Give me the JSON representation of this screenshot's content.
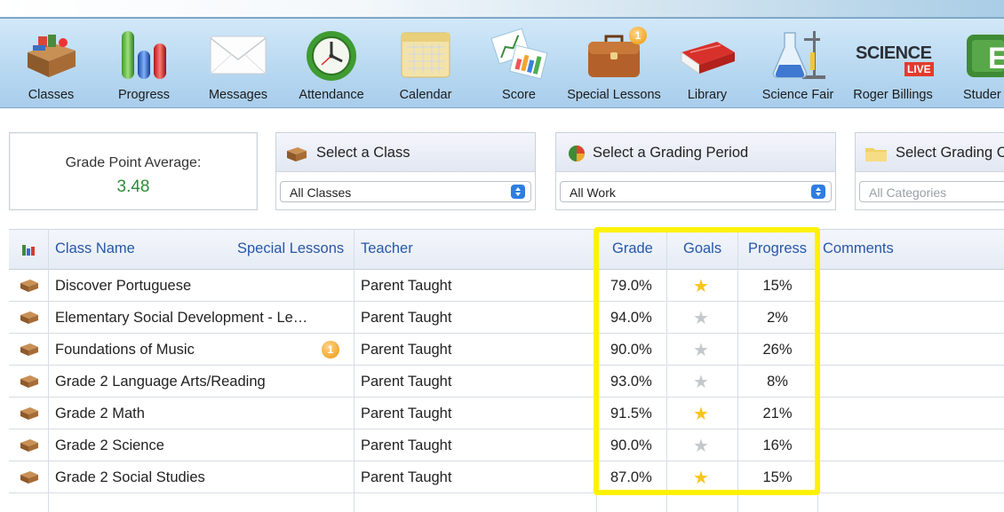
{
  "toolbar": {
    "items": [
      {
        "label": "Classes",
        "icon": "desk-icon"
      },
      {
        "label": "Progress",
        "icon": "bar-chart-icon"
      },
      {
        "label": "Messages",
        "icon": "envelope-icon"
      },
      {
        "label": "Attendance",
        "icon": "clock-icon"
      },
      {
        "label": "Calendar",
        "icon": "calendar-icon"
      },
      {
        "label": "Score",
        "icon": "charts-icon"
      },
      {
        "label": "Special Lessons",
        "icon": "briefcase-icon",
        "badge": "1"
      },
      {
        "label": "Library",
        "icon": "book-icon"
      },
      {
        "label": "Science Fair",
        "icon": "flask-icon"
      },
      {
        "label": "Roger Billings",
        "icon": "science-live-logo",
        "logo_text": "SCIENCE",
        "logo_sub": "LIVE"
      },
      {
        "label": "Studer",
        "icon": "student-icon"
      }
    ]
  },
  "gpa": {
    "label": "Grade Point Average:",
    "value": "3.48",
    "value_color": "#2e8b3a"
  },
  "filters": [
    {
      "title": "Select a Class",
      "value": "All Classes",
      "icon": "class-box-icon"
    },
    {
      "title": "Select a Grading Period",
      "value": "All Work",
      "icon": "pie-icon"
    },
    {
      "title": "Select Grading C",
      "value": "All Categories",
      "icon": "folder-icon"
    }
  ],
  "table": {
    "headers": {
      "class_name": "Class Name",
      "special_lessons": "Special Lessons",
      "teacher": "Teacher",
      "grade": "Grade",
      "goals": "Goals",
      "progress": "Progress",
      "comments": "Comments"
    },
    "rows": [
      {
        "class_name": "Discover Portuguese",
        "teacher": "Parent Taught",
        "grade": "79.0%",
        "goal": "gold",
        "progress": "15%",
        "badge": ""
      },
      {
        "class_name": "Elementary Social Development - Le…",
        "teacher": "Parent Taught",
        "grade": "94.0%",
        "goal": "gray",
        "progress": "2%",
        "badge": ""
      },
      {
        "class_name": "Foundations of Music",
        "teacher": "Parent Taught",
        "grade": "90.0%",
        "goal": "gray",
        "progress": "26%",
        "badge": "1"
      },
      {
        "class_name": "Grade 2 Language Arts/Reading",
        "teacher": "Parent Taught",
        "grade": "93.0%",
        "goal": "gray",
        "progress": "8%",
        "badge": ""
      },
      {
        "class_name": "Grade 2 Math",
        "teacher": "Parent Taught",
        "grade": "91.5%",
        "goal": "gold",
        "progress": "21%",
        "badge": ""
      },
      {
        "class_name": "Grade 2 Science",
        "teacher": "Parent Taught",
        "grade": "90.0%",
        "goal": "gray",
        "progress": "16%",
        "badge": ""
      },
      {
        "class_name": "Grade 2 Social Studies",
        "teacher": "Parent Taught",
        "grade": "87.0%",
        "goal": "gold",
        "progress": "15%",
        "badge": ""
      }
    ]
  },
  "colors": {
    "highlight": "#fff200",
    "header_text": "#2857a6",
    "star_gold": "#f7c51a",
    "star_gray": "#c4c8cc",
    "badge": "#f3a92d"
  }
}
